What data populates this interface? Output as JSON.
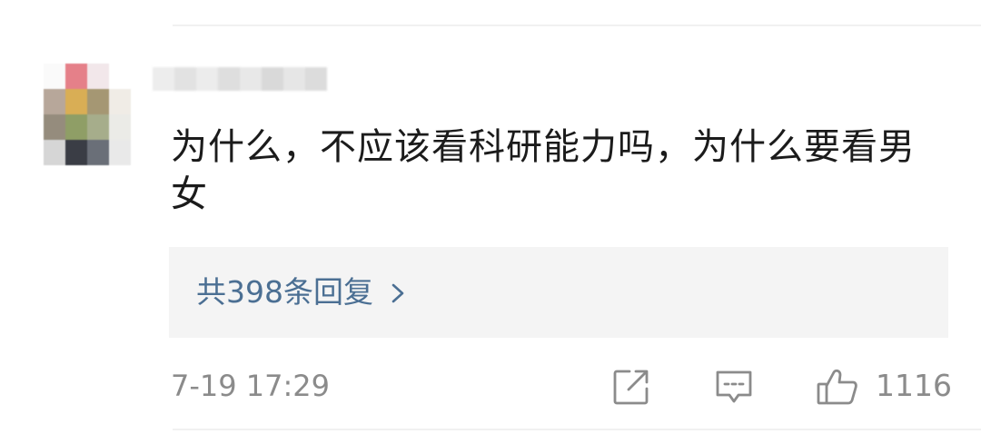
{
  "comment": {
    "text": "为什么，不应该看科研能力吗，为什么要看男女",
    "replies_label": "共398条回复",
    "timestamp": "7-19 17:29",
    "like_count": "1116"
  },
  "icons": {
    "replies_chevron": "chevron-right-icon",
    "share": "share-icon",
    "comment": "comment-icon",
    "like": "thumbs-up-icon"
  },
  "colors": {
    "link": "#4b6f93",
    "meta": "#8b8b8b",
    "text": "#1b1b1b",
    "reply_bg": "#f4f4f4"
  }
}
